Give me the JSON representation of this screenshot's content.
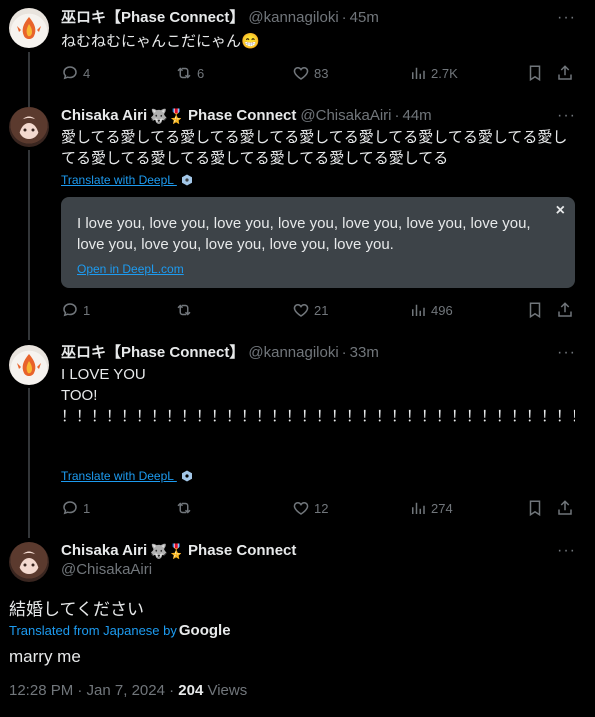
{
  "colors": {
    "background": "#000000",
    "text": "#e7e9ea",
    "muted": "#71767b",
    "link": "#1d9bf0",
    "translate_box": "#3d4348"
  },
  "tweets": [
    {
      "name": "巫ロキ【Phase Connect】",
      "handle": "@kannagiloki",
      "time": "45m",
      "text": "ねむねむにゃんこだにゃん😁",
      "replies": "4",
      "retweets": "6",
      "likes": "83",
      "views": "2.7K"
    },
    {
      "name": "Chisaka Airi",
      "badges": "🐺🎖️",
      "org": "Phase Connect",
      "handle": "@ChisakaAiri",
      "time": "44m",
      "text": "愛してる愛してる愛してる愛してる愛してる愛してる愛してる愛してる愛してる愛してる愛してる愛してる愛してる愛してる愛してる",
      "translate_label": "Translate with DeepL",
      "translation": {
        "text": "I love you, love you, love you, love you, love you, love you, love you, love you, love you, love you, love you, love you.",
        "open_label": "Open in DeepL.com",
        "close": "×"
      },
      "replies": "1",
      "retweets": "",
      "likes": "21",
      "views": "496"
    },
    {
      "name": "巫ロキ【Phase Connect】",
      "handle": "@kannagiloki",
      "time": "33m",
      "text_line1": "I LOVE YOU",
      "text_rest": "TOO! ！！！！！！！！！！！！！！！！！！！！！！！！！！！！！！！！！！！！！！！！！！！！！！！！！！！！！！！！！！！！！！！！！！！！！！！！！！！！！！！！！！！！！！！！！！！！！！！！！！！！",
      "translate_label": "Translate with DeepL",
      "replies": "1",
      "retweets": "",
      "likes": "12",
      "views": "274"
    }
  ],
  "main": {
    "name": "Chisaka Airi",
    "badges": "🐺🎖️",
    "org": "Phase Connect",
    "handle": "@ChisakaAiri",
    "text": "結婚してください",
    "translated_from": "Translated from Japanese by",
    "translator": "Google",
    "translation": "marry me",
    "time": "12:28 PM · Jan 7, 2024 ·",
    "views_count": "204",
    "views_label": "Views"
  }
}
